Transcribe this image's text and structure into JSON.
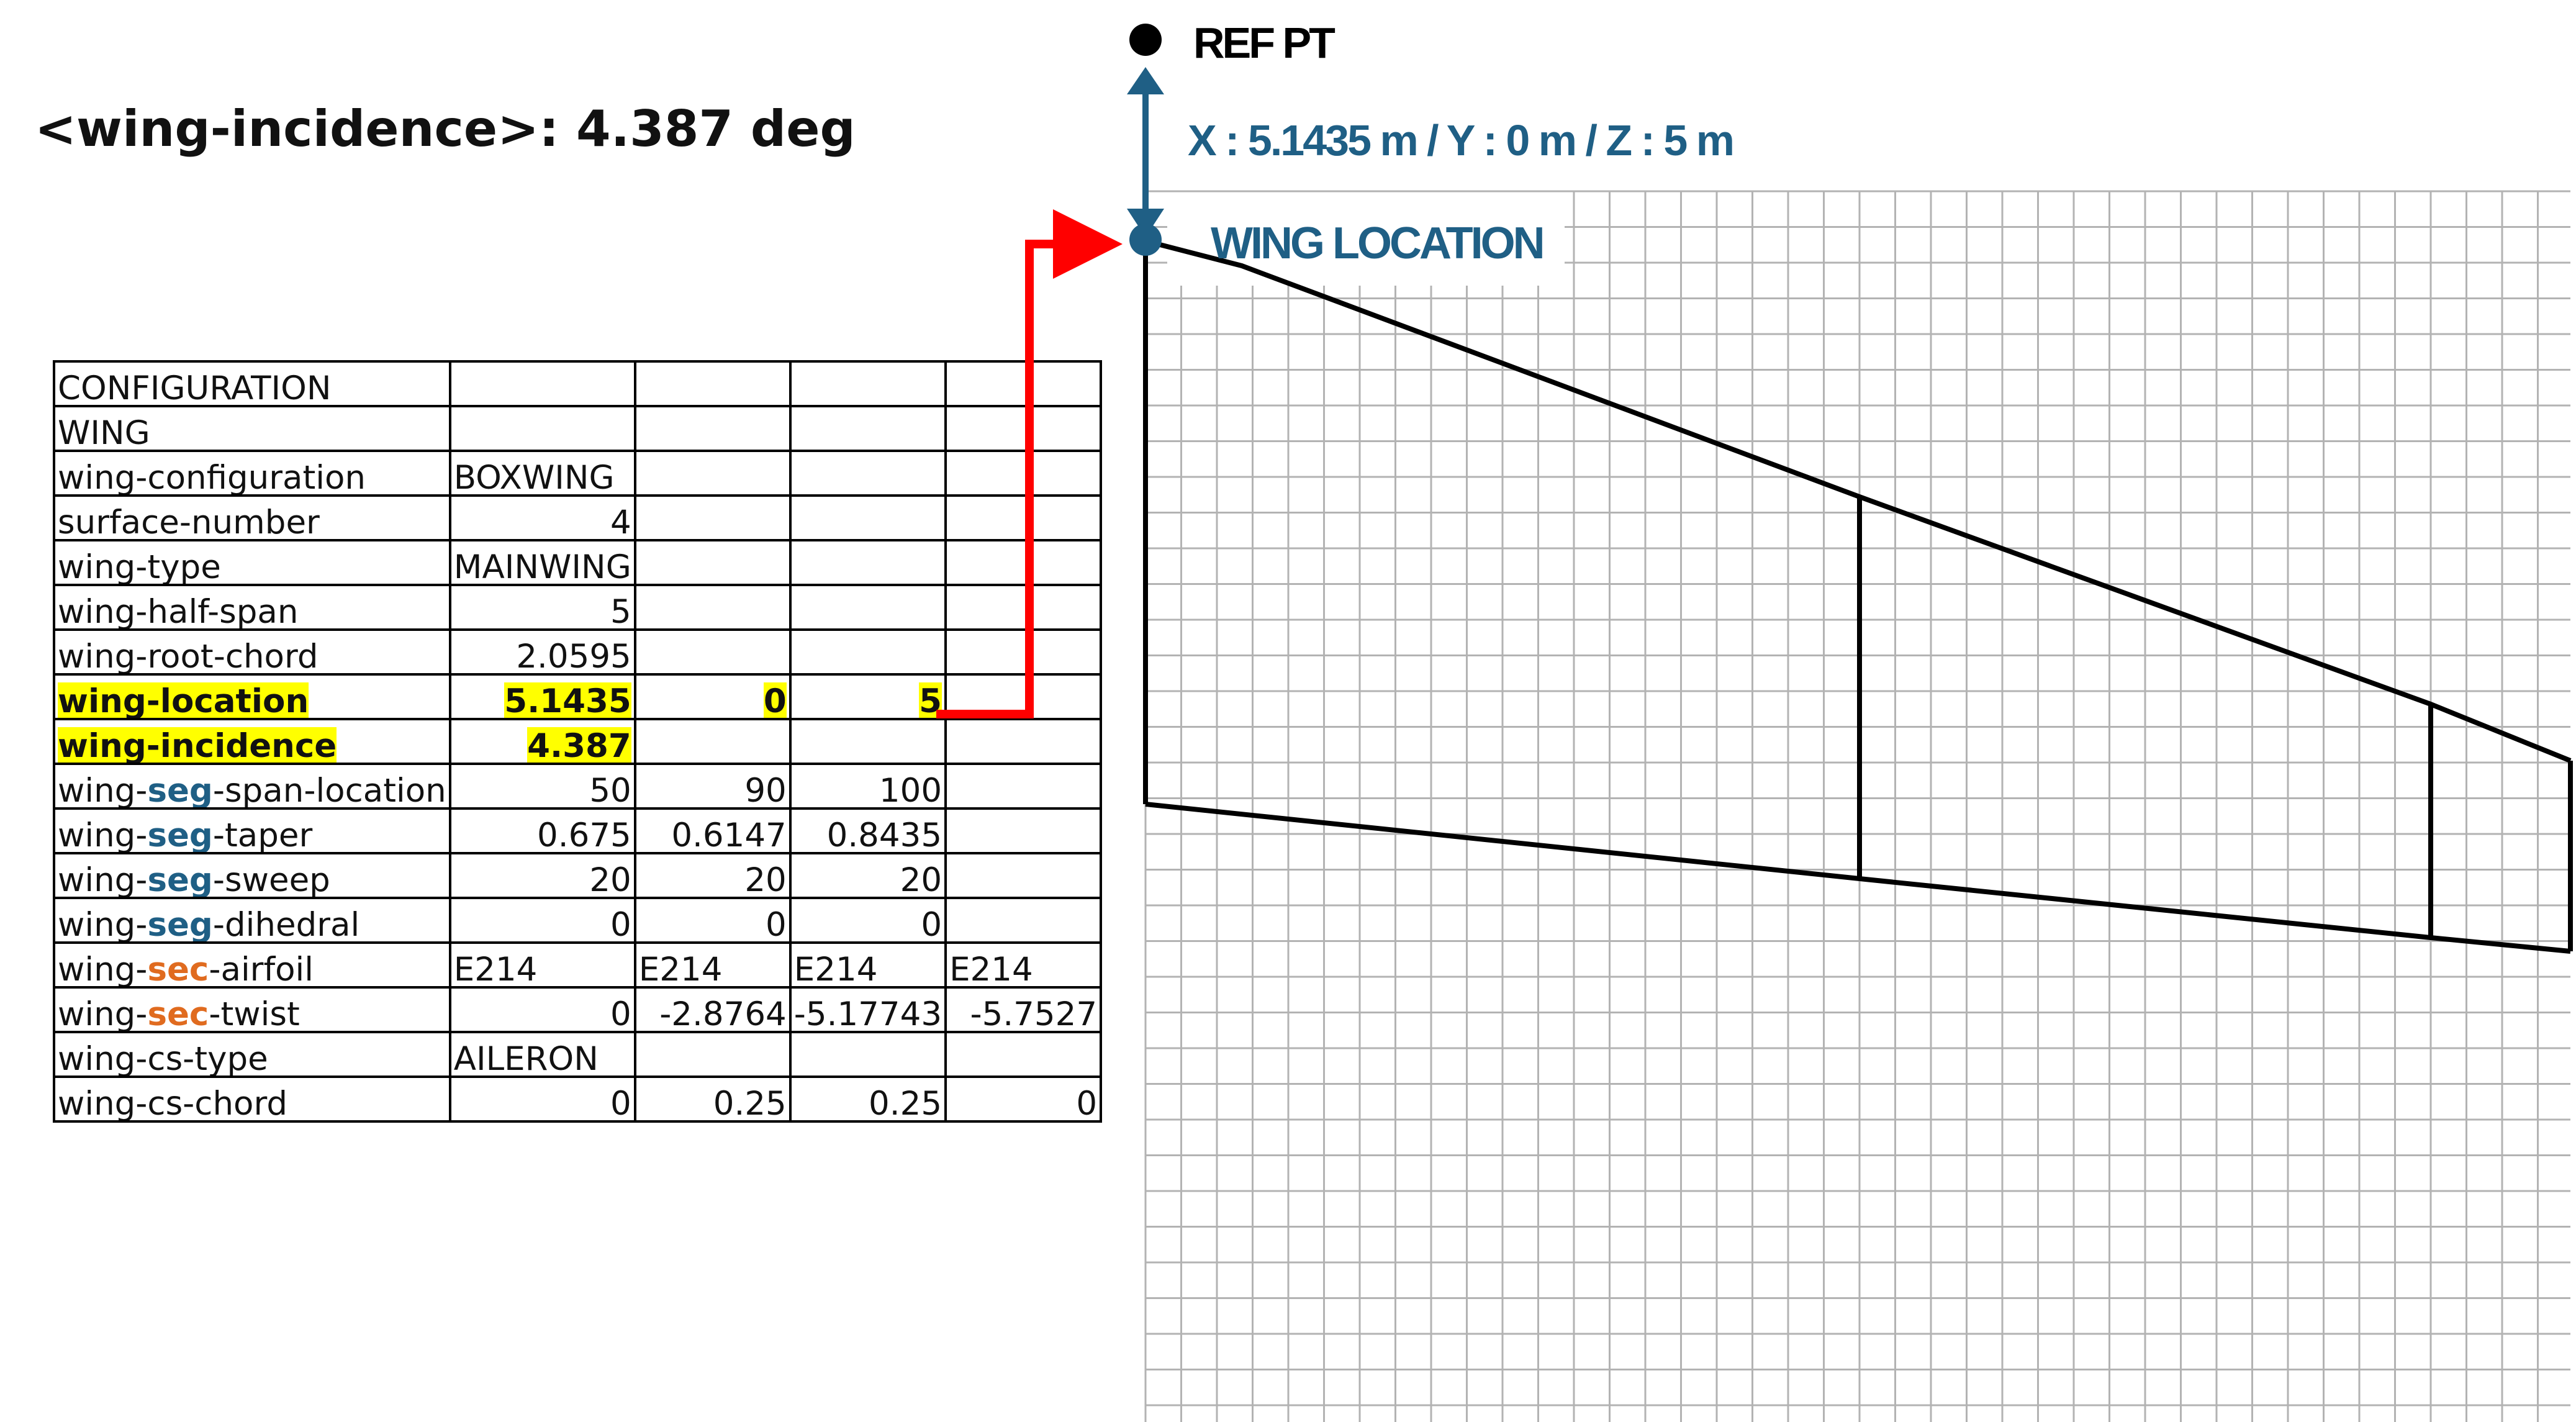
{
  "title": "<wing-incidence>: 4.387 deg",
  "diagram": {
    "ref_point_label": "REF PT",
    "offset_label": "X : 5.1435 m / Y : 0 m / Z : 5 m",
    "wing_location_label": "WING LOCATION",
    "colors": {
      "location_blue": "#1f5f85",
      "arrow_red": "#ff0000",
      "grid": "#b3b3b3",
      "highlight": "#ffff00",
      "sec_orange": "#e06b1f"
    }
  },
  "table": {
    "rows": [
      {
        "label": "CONFIGURATION",
        "cells": [
          "",
          "",
          "",
          ""
        ]
      },
      {
        "label": "WING",
        "cells": [
          "",
          "",
          "",
          ""
        ]
      },
      {
        "label": "wing-configuration",
        "cells": [
          "BOXWING",
          "",
          "",
          ""
        ]
      },
      {
        "label": "surface-number",
        "cells": [
          "4",
          "",
          "",
          ""
        ]
      },
      {
        "label": "wing-type",
        "cells": [
          "MAINWING",
          "",
          "",
          ""
        ]
      },
      {
        "label": "wing-half-span",
        "cells": [
          "5",
          "",
          "",
          ""
        ]
      },
      {
        "label": "wing-root-chord",
        "cells": [
          "2.0595",
          "",
          "",
          ""
        ]
      },
      {
        "label": "wing-location",
        "cells": [
          "5.1435",
          "0",
          "5",
          ""
        ],
        "highlight": true
      },
      {
        "label": "wing-incidence",
        "cells": [
          "4.387",
          "",
          "",
          ""
        ],
        "highlight": true
      },
      {
        "label_pre": "wing-",
        "label_key": "seg",
        "label_post": "-span-location",
        "cells": [
          "50",
          "90",
          "100",
          ""
        ]
      },
      {
        "label_pre": "wing-",
        "label_key": "seg",
        "label_post": "-taper",
        "cells": [
          "0.675",
          "0.6147",
          "0.8435",
          ""
        ]
      },
      {
        "label_pre": "wing-",
        "label_key": "seg",
        "label_post": "-sweep",
        "cells": [
          "20",
          "20",
          "20",
          ""
        ]
      },
      {
        "label_pre": "wing-",
        "label_key": "seg",
        "label_post": "-dihedral",
        "cells": [
          "0",
          "0",
          "0",
          ""
        ]
      },
      {
        "label_pre": "wing-",
        "label_key": "sec",
        "label_post": "-airfoil",
        "cells": [
          "E214",
          "E214",
          "E214",
          "E214"
        ]
      },
      {
        "label_pre": "wing-",
        "label_key": "sec",
        "label_post": "-twist",
        "cells": [
          "0",
          "-2.8764",
          "-5.17743",
          "-5.7527"
        ]
      },
      {
        "label": "wing-cs-type",
        "cells": [
          "AILERON",
          "",
          "",
          ""
        ]
      },
      {
        "label": "wing-cs-chord",
        "cells": [
          "0",
          "0.25",
          "0.25",
          "0"
        ]
      }
    ]
  }
}
